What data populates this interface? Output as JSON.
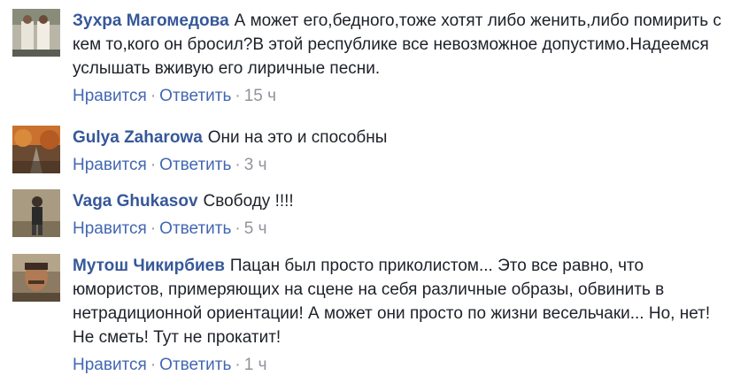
{
  "comments": [
    {
      "author": "Зухра Магомедова",
      "text": "А может его,бедного,тоже хотят либо женить,либо помирить с кем то,кого он бросил?В этой республике все невозможное допустимо.Надеемся услышать вживую его лиричные песни.",
      "like": "Нравится",
      "reply": "Ответить",
      "time": "15 ч"
    },
    {
      "author": "Gulya Zaharowa",
      "text": "Они на это и способны",
      "like": "Нравится",
      "reply": "Ответить",
      "time": "3 ч"
    },
    {
      "author": "Vaga Ghukasov",
      "text": "Свободу !!!!",
      "like": "Нравится",
      "reply": "Ответить",
      "time": "5 ч"
    },
    {
      "author": "Мутош Чикирбиев",
      "text": "Пацан был просто приколистом... Это все равно, что юмористов, примеряющих на сцене на себя различные образы, обвинить в нетрадиционной ориентации! А может они просто по жизни весельчаки... Но, нет! Не сметь! Тут не прокатит!",
      "like": "Нравится",
      "reply": "Ответить",
      "time": "1 ч"
    }
  ],
  "separator": "·",
  "colors": {
    "author": "#365899",
    "link": "#4267b2",
    "meta": "#90949c",
    "text": "#1d2129"
  }
}
